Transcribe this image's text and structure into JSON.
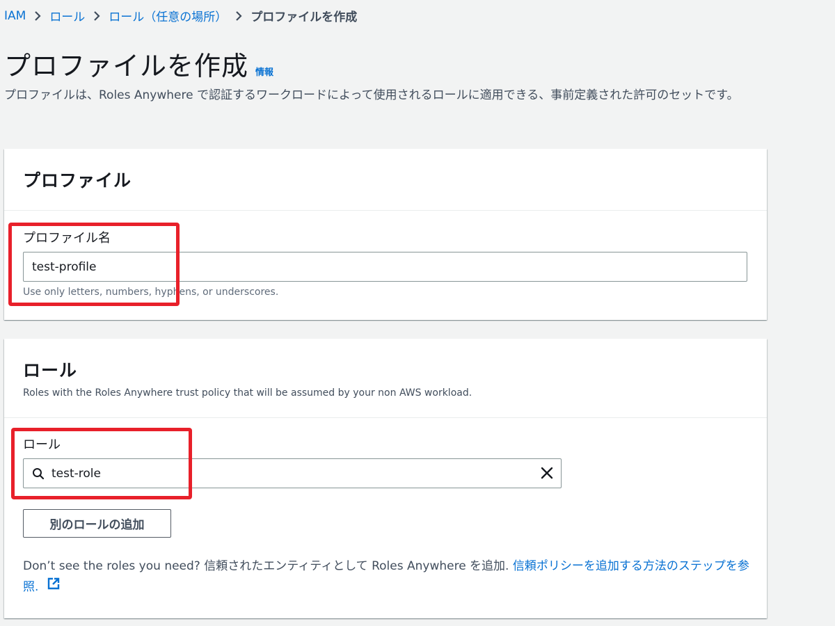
{
  "breadcrumb": {
    "items": [
      "IAM",
      "ロール",
      "ロール（任意の場所）"
    ],
    "current": "プロファイルを作成"
  },
  "header": {
    "title": "プロファイルを作成",
    "info_link": "情報",
    "description": "プロファイルは、Roles Anywhere で認証するワークロードによって使用されるロールに適用できる、事前定義された許可のセットです。"
  },
  "profile_section": {
    "title": "プロファイル",
    "name_label": "プロファイル名",
    "name_value": "test-profile",
    "name_hint": "Use only letters, numbers, hyphens, or underscores."
  },
  "role_section": {
    "title": "ロール",
    "subtitle": "Roles with the Roles Anywhere trust policy that will be assumed by your non AWS workload.",
    "role_label": "ロール",
    "role_value": "test-role",
    "add_role_button": "別のロールの追加",
    "note_text": "Don’t see the roles you need? 信頼されたエンティティとして Roles Anywhere を追加. ",
    "note_link": "信頼ポリシーを追加する方法のステップを参照."
  },
  "colors": {
    "link": "#0972d3",
    "highlight_red": "#e8202a",
    "background": "#f2f3f3"
  },
  "icons": [
    "chevron-right-icon",
    "search-icon",
    "close-icon",
    "external-link-icon"
  ]
}
